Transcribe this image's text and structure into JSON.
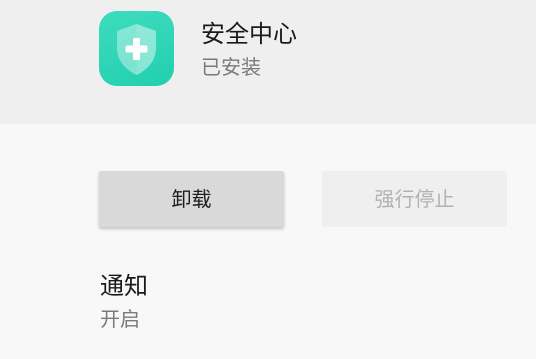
{
  "app": {
    "name": "安全中心",
    "status": "已安装",
    "icon": "shield-plus-icon",
    "icon_color": "#2dd5b6"
  },
  "actions": {
    "uninstall_label": "卸载",
    "force_stop_label": "强行停止"
  },
  "notification": {
    "title": "通知",
    "value": "开启"
  }
}
